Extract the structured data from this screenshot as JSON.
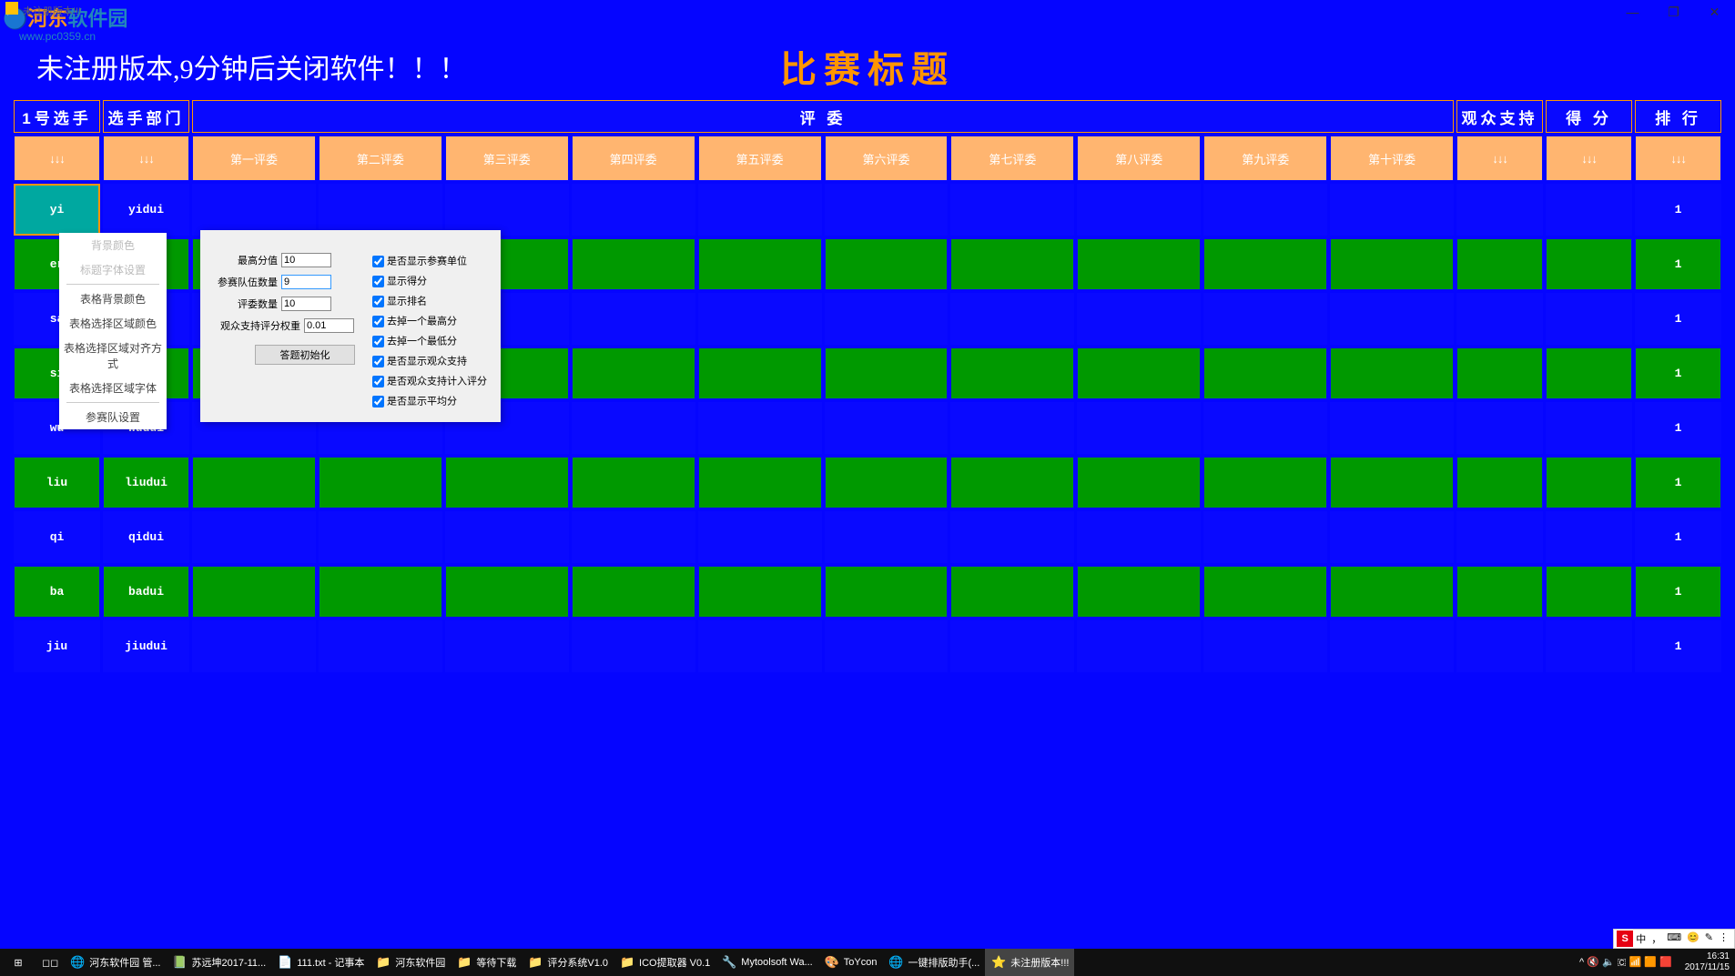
{
  "window": {
    "title": "未注册版本!!!",
    "minimize": "—",
    "maximize": "❐",
    "close": "✕"
  },
  "watermark": {
    "logo_a": "河东",
    "logo_b": "软件园",
    "url": "www.pc0359.cn"
  },
  "header": {
    "unregistered": "未注册版本,9分钟后关闭软件！！！",
    "main_title": "比赛标题"
  },
  "columns_row1": {
    "contestant": "1号选手",
    "dept": "选手部门",
    "judges": "评 委",
    "audience": "观众支持",
    "score": "得 分",
    "rank": "排 行"
  },
  "columns_row2": {
    "arrow": "↓↓↓",
    "judges": [
      "第一评委",
      "第二评委",
      "第三评委",
      "第四评委",
      "第五评委",
      "第六评委",
      "第七评委",
      "第八评委",
      "第九评委",
      "第十评委"
    ]
  },
  "rows": [
    {
      "p": "yi",
      "d": "yidui",
      "rank": "1",
      "color": "blue",
      "sel": true
    },
    {
      "p": "er",
      "d": "",
      "rank": "1",
      "color": "green"
    },
    {
      "p": "sa",
      "d": "",
      "rank": "1",
      "color": "blue"
    },
    {
      "p": "si",
      "d": "",
      "rank": "1",
      "color": "green"
    },
    {
      "p": "wu",
      "d": "wudui",
      "rank": "1",
      "color": "blue"
    },
    {
      "p": "liu",
      "d": "liudui",
      "rank": "1",
      "color": "green"
    },
    {
      "p": "qi",
      "d": "qidui",
      "rank": "1",
      "color": "blue"
    },
    {
      "p": "ba",
      "d": "badui",
      "rank": "1",
      "color": "green"
    },
    {
      "p": "jiu",
      "d": "jiudui",
      "rank": "1",
      "color": "blue"
    }
  ],
  "menu": {
    "bg_color": "背景颜色",
    "title_font": "标题字体设置",
    "tbl_bg": "表格背景颜色",
    "tbl_sel_color": "表格选择区域颜色",
    "tbl_sel_align": "表格选择区域对齐方式",
    "tbl_sel_font": "表格选择区域字体",
    "team_settings": "参赛队设置"
  },
  "settings": {
    "max_score_label": "最高分值",
    "max_score_value": "10",
    "team_count_label": "参赛队伍数量",
    "team_count_value": "9",
    "judge_count_label": "评委数量",
    "judge_count_value": "10",
    "audience_weight_label": "观众支持评分权重",
    "audience_weight_value": "0.01",
    "init_button": "答题初始化",
    "cb": {
      "show_unit": "是否显示参赛单位",
      "show_score": "显示得分",
      "show_rank": "显示排名",
      "drop_high": "去掉一个最高分",
      "drop_low": "去掉一个最低分",
      "show_audience": "是否显示观众支持",
      "count_audience": "是否观众支持计入评分",
      "show_avg": "是否显示平均分"
    }
  },
  "taskbar": {
    "items": [
      {
        "ico": "🌐",
        "label": "河东软件园 管..."
      },
      {
        "ico": "📗",
        "label": "苏远坤2017-11..."
      },
      {
        "ico": "📄",
        "label": "111.txt - 记事本"
      },
      {
        "ico": "📁",
        "label": "河东软件园"
      },
      {
        "ico": "📁",
        "label": "等待下载"
      },
      {
        "ico": "📁",
        "label": "评分系统V1.0"
      },
      {
        "ico": "📁",
        "label": "ICO提取器 V0.1"
      },
      {
        "ico": "🔧",
        "label": "Mytoolsoft Wa..."
      },
      {
        "ico": "🎨",
        "label": "ToYcon"
      },
      {
        "ico": "🌐",
        "label": "一键排版助手(..."
      },
      {
        "ico": "⭐",
        "label": "未注册版本!!!",
        "active": true
      }
    ],
    "time": "16:31",
    "date": "2017/11/15"
  },
  "lang": {
    "sogou": "S",
    "items": [
      "中",
      "，",
      "⌨",
      "😊",
      "✎",
      "⋮"
    ]
  }
}
